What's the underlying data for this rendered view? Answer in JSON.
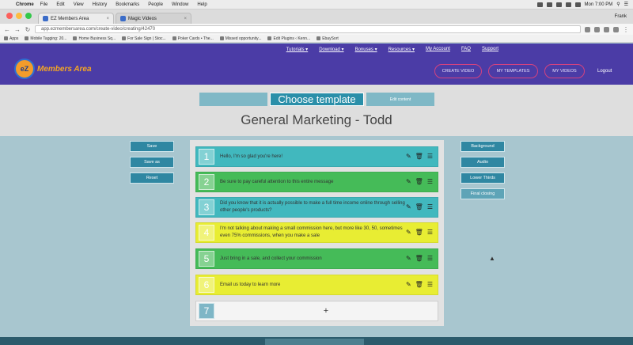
{
  "mac_menu": {
    "app": "Chrome",
    "items": [
      "File",
      "Edit",
      "View",
      "History",
      "Bookmarks",
      "People",
      "Window",
      "Help"
    ],
    "clock": "Mon 7:00 PM"
  },
  "browser": {
    "tabs": [
      "EZ Members Area",
      "Magic Videos"
    ],
    "profile": "Frank",
    "url": "app.ezmembersarea.com/create-video/creating/42470",
    "bookmarks": [
      "Apps",
      "Mobile Tagging: 20...",
      "Home Business Sq...",
      "For Sale Sign | Stoc...",
      "Poker Cards • The...",
      "Missed opportunity...",
      "Edit Plugins ‹ Kenn...",
      "EbaySort"
    ]
  },
  "site": {
    "logo_badge": "eZ",
    "logo_text": "Members Area",
    "topnav": [
      "Tutorials ▾",
      "Download ▾",
      "Bonuses ▾",
      "Resources ▾",
      "My Account",
      "FAQ",
      "Support"
    ],
    "header_buttons": [
      "CREATE VIDEO",
      "MY TEMPLATES",
      "MY VIDEOS"
    ],
    "logout": "Logout"
  },
  "steps": {
    "left_blank": "",
    "current": "Choose template",
    "next": "Edit content"
  },
  "page_title": "General Marketing - Todd",
  "left_buttons": [
    "Save",
    "Save as",
    "Reset"
  ],
  "right_buttons": [
    "Background",
    "Audio",
    "Lower Thirds",
    "Final closing"
  ],
  "scenes": [
    {
      "num": "1",
      "text": "Hello, I'm so glad you're here!",
      "color": "teal"
    },
    {
      "num": "2",
      "text": "Be sure to pay careful attention to this entire message",
      "color": "green"
    },
    {
      "num": "3",
      "text": "Did you know that it is actually possible to make a full time income online through selling other people's products?",
      "color": "teal"
    },
    {
      "num": "4",
      "text": "I'm not talking about making a small commission here, but more like 30, 50, sometimes even 75% commissions, when you make a sale",
      "color": "yellow"
    },
    {
      "num": "5",
      "text": "Just bring in a sale, and collect your commission",
      "color": "green"
    },
    {
      "num": "6",
      "text": "Email us today to learn more",
      "color": "yellow"
    }
  ],
  "add_row": {
    "num": "7",
    "symbol": "+"
  },
  "icons": {
    "edit": "edit-icon",
    "delete": "trash-icon",
    "drag": "menu-icon"
  },
  "colors": {
    "header": "#4b3ca6",
    "accent_pink": "#d4427f",
    "teal": "#41b8be",
    "green": "#45bb58",
    "yellow": "#e8ed33",
    "button": "#2f87a2"
  }
}
